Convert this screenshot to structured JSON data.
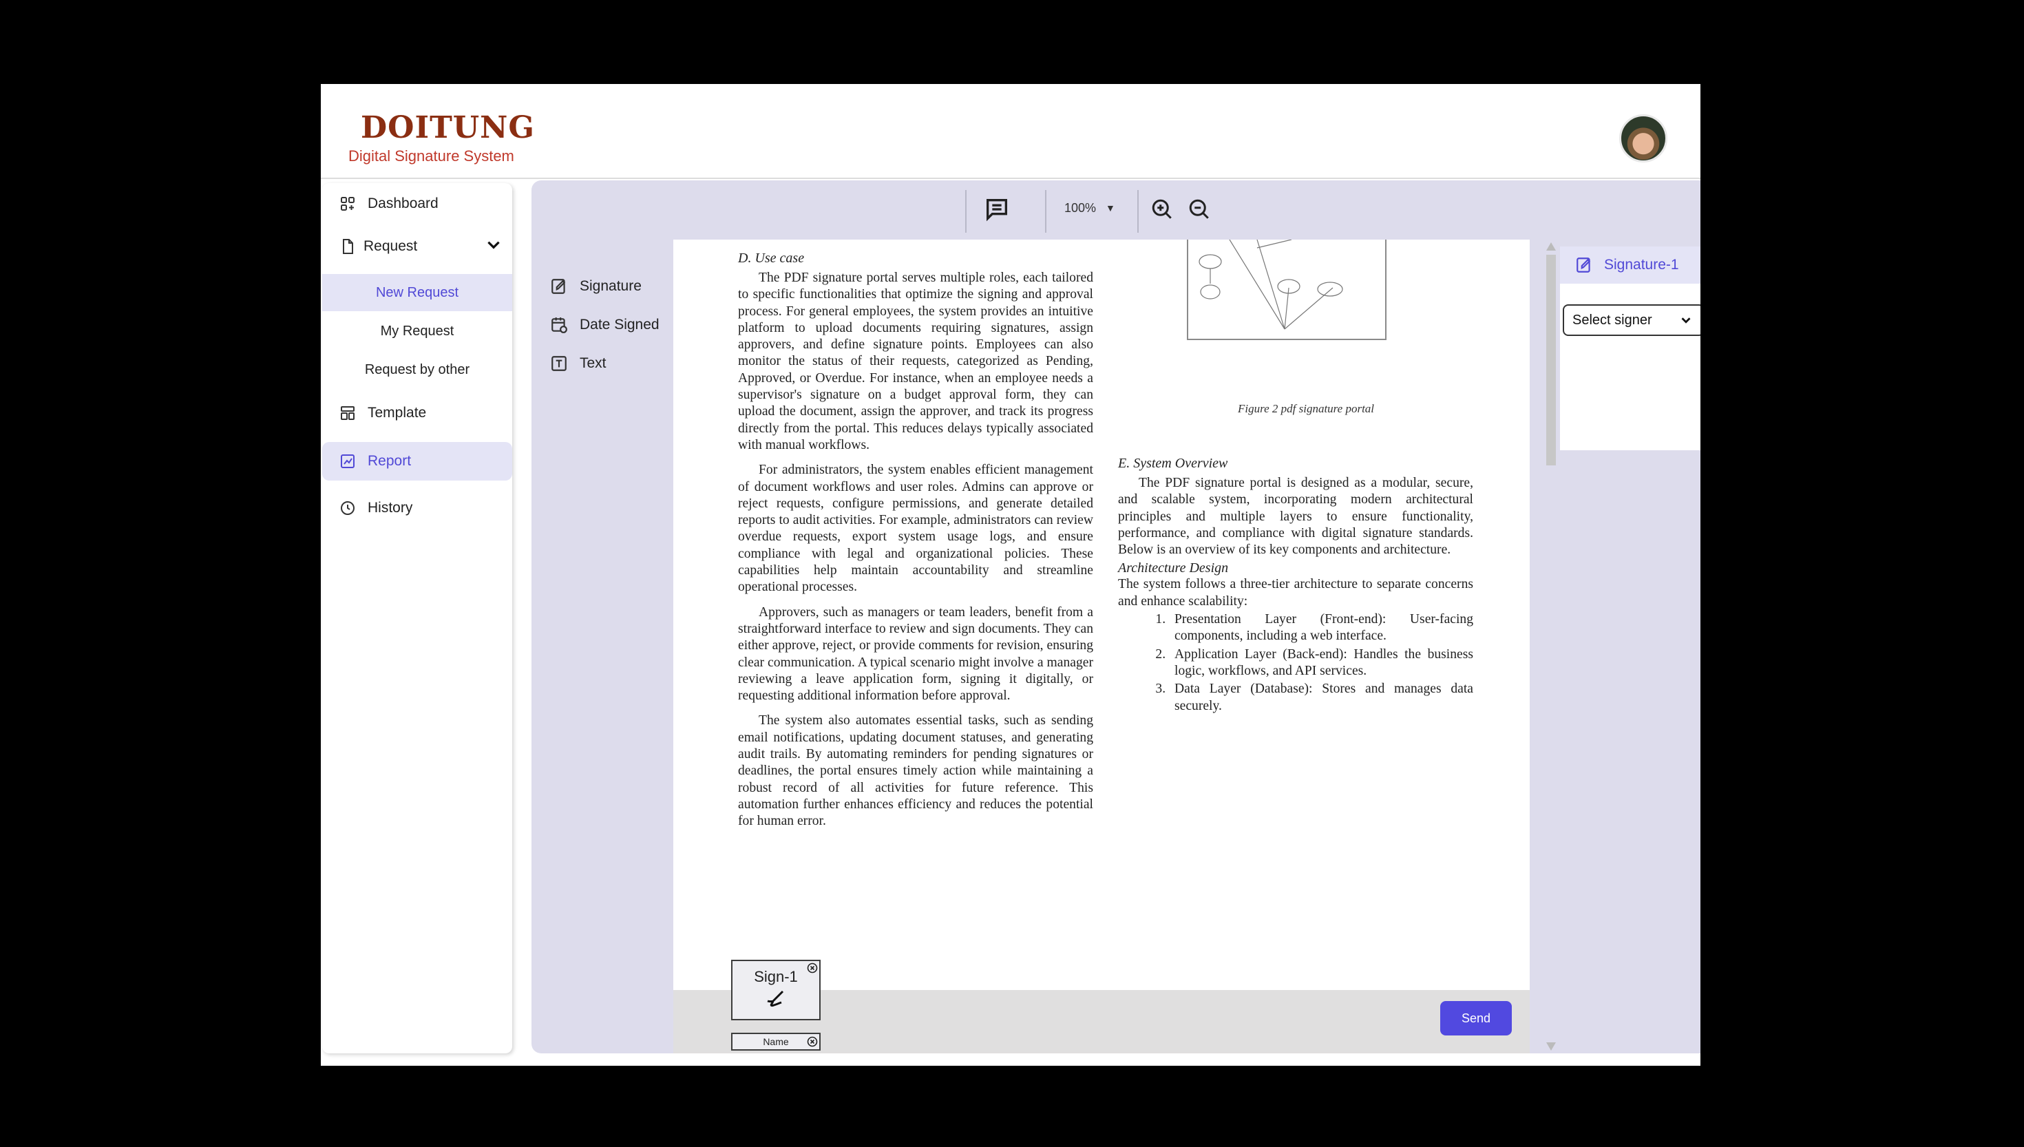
{
  "header": {
    "logo_text": "DOITUNG",
    "logo_subtitle": "Digital Signature System"
  },
  "sidebar": {
    "items": [
      {
        "label": "Dashboard",
        "icon": "grid-icon"
      },
      {
        "label": "Request",
        "icon": "file-icon"
      },
      {
        "label": "Template",
        "icon": "template-icon"
      },
      {
        "label": "Report",
        "icon": "chart-icon",
        "active": true
      },
      {
        "label": "History",
        "icon": "clock-icon"
      }
    ],
    "sub_items": [
      {
        "label": "New Request",
        "active": true
      },
      {
        "label": "My Request"
      },
      {
        "label": "Request by other"
      }
    ]
  },
  "toolbar": {
    "zoom": "100%"
  },
  "tools": [
    {
      "label": "Signature",
      "icon": "signature-icon"
    },
    {
      "label": "Date Signed",
      "icon": "calendar-icon"
    },
    {
      "label": "Text",
      "icon": "text-icon"
    }
  ],
  "document": {
    "left_heading": "D.  Use case",
    "left_paragraphs": [
      "The PDF signature portal serves multiple roles, each tailored to specific functionalities that optimize the signing and approval process. For general employees, the system provides an intuitive platform to upload documents requiring signatures, assign approvers, and define signature points. Employees can also monitor the status of their requests, categorized as Pending, Approved, or Overdue. For instance, when an employee needs a supervisor's signature on a budget approval form, they can upload the document, assign the approver, and track its progress directly from the portal. This reduces delays typically associated with manual workflows.",
      "For administrators, the system enables efficient management of document workflows and user roles. Admins can approve or reject requests, configure permissions, and generate detailed reports to audit activities. For example, administrators can review overdue requests, export system usage logs, and ensure compliance with legal and organizational policies. These capabilities help maintain accountability and streamline operational processes.",
      "Approvers, such as managers or team leaders, benefit from a straightforward interface to review and sign documents. They can either approve, reject, or provide comments for revision, ensuring clear communication. A typical scenario might involve a manager reviewing a leave application form, signing it digitally, or requesting additional information before approval.",
      "The system also automates essential tasks, such as sending email notifications, updating document statuses, and generating audit trails. By automating reminders for pending signatures or deadlines, the portal ensures timely action while maintaining a robust record of all activities for future reference. This automation further enhances efficiency and reduces the potential for human error."
    ],
    "figure_caption": "Figure 2 pdf signature portal",
    "right_heading": "E.  System Overview",
    "right_intro": "The PDF signature portal is designed as a modular, secure, and scalable system, incorporating modern architectural principles and multiple layers to ensure functionality, performance, and compliance with digital signature standards. Below is an overview of its key components and architecture.",
    "arch_heading": "Architecture Design",
    "arch_text": "The system follows a three-tier architecture to separate concerns and enhance scalability:",
    "arch_list": [
      "Presentation Layer (Front-end): User-facing components, including a web interface.",
      "Application Layer (Back-end): Handles the business logic, workflows, and API services.",
      "Data Layer (Database): Stores and manages data securely."
    ]
  },
  "fields": {
    "sign_label": "Sign-1",
    "name_label": "Name"
  },
  "actions": {
    "send_label": "Send"
  },
  "right_panel": {
    "signer_tab": "Signature-1",
    "select_placeholder": "Select signer"
  },
  "colors": {
    "accent": "#5149d6",
    "brand": "#8b2e12",
    "panel": "#dddcec"
  }
}
